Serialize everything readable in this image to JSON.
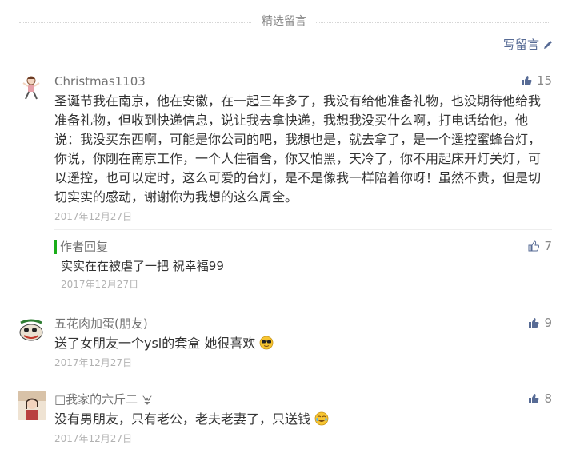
{
  "header": {
    "title": "精选留言",
    "write_label": "写留言"
  },
  "comments": [
    {
      "name": "Christmas1103",
      "likes": "15",
      "content": "圣诞节我在南京，他在安徽，在一起三年多了，我没有给他准备礼物，也没期待他给我准备礼物，但收到快递信息，说让我去拿快递，我想我没买什么啊，打电话给他，他说：我没买东西啊，可能是你公司的吧，我想也是，就去拿了，是一个遥控蜜蜂台灯，你说，你刚在南京工作，一个人住宿舍，你又怕黑，天冷了，你不用起床开灯关灯，可以遥控，也可以定时，这么可爱的台灯，是不是像我一样陪着你呀！虽然不贵，但是切切实实的感动，谢谢你为我想的这么周全。",
      "time": "2017年12月27日",
      "reply": {
        "label": "作者回复",
        "likes": "7",
        "content": "实实在在被虐了一把  祝幸福99",
        "time": "2017年12月27日"
      }
    },
    {
      "name": "五花肉加蛋(朋友)",
      "likes": "9",
      "content": "送了女朋友一个ysl的套盒 她很喜欢",
      "time": "2017年12月27日"
    },
    {
      "name": "□我家的六斤二",
      "likes": "8",
      "content": "没有男朋友，只有老公，老夫老妻了，只送钱",
      "time": "2017年12月27日"
    }
  ],
  "colors": {
    "link": "#576b95",
    "reply_bar": "#1aad19",
    "meta": "#b2b2b2"
  }
}
